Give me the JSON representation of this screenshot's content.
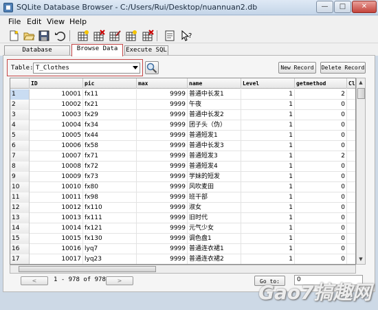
{
  "window": {
    "title": "SQLite Database Browser - C:/Users/Rui/Desktop/nuannuan2.db"
  },
  "menu": [
    "File",
    "Edit",
    "View",
    "Help"
  ],
  "toolbar": {
    "icons": [
      "new-database-icon",
      "open-database-icon",
      "save-icon",
      "undo-icon",
      "create-table-icon",
      "delete-table-icon",
      "modify-table-icon",
      "create-index-icon",
      "delete-index-icon",
      "log-window-icon",
      "whats-this-icon"
    ]
  },
  "tabs": [
    {
      "label": "Database Structure",
      "active": false
    },
    {
      "label": "Browse Data",
      "active": true
    },
    {
      "label": "Execute SQL",
      "active": false
    }
  ],
  "browse": {
    "table_label": "Table:",
    "table_value": "T_Clothes",
    "new_record_label": "New Record",
    "delete_record_label": "Delete Record"
  },
  "grid": {
    "columns": [
      "ID",
      "pic",
      "max",
      "name",
      "Level",
      "getmethod",
      "Clе"
    ],
    "rows": [
      [
        "1",
        "10001",
        "fx11",
        "9999",
        "普通中长发1",
        "1",
        "2"
      ],
      [
        "2",
        "10002",
        "fx21",
        "9999",
        "午夜",
        "1",
        "0"
      ],
      [
        "3",
        "10003",
        "fx29",
        "9999",
        "普通中长发2",
        "1",
        "0"
      ],
      [
        "4",
        "10004",
        "fx34",
        "9999",
        "团子头（伪）",
        "1",
        "0"
      ],
      [
        "5",
        "10005",
        "fx44",
        "9999",
        "普通短发1",
        "1",
        "0"
      ],
      [
        "6",
        "10006",
        "fx58",
        "9999",
        "普通中长发3",
        "1",
        "0"
      ],
      [
        "7",
        "10007",
        "fx71",
        "9999",
        "普通短发3",
        "1",
        "2"
      ],
      [
        "8",
        "10008",
        "fx72",
        "9999",
        "普通短发4",
        "1",
        "0"
      ],
      [
        "9",
        "10009",
        "fx73",
        "9999",
        "学妹的短发",
        "1",
        "0"
      ],
      [
        "10",
        "10010",
        "fx80",
        "9999",
        "风吹麦田",
        "1",
        "0"
      ],
      [
        "11",
        "10011",
        "fx98",
        "9999",
        "班干部",
        "1",
        "0"
      ],
      [
        "12",
        "10012",
        "fx110",
        "9999",
        "淑女",
        "1",
        "0"
      ],
      [
        "13",
        "10013",
        "fx111",
        "9999",
        "旧时代",
        "1",
        "0"
      ],
      [
        "14",
        "10014",
        "fx121",
        "9999",
        "元气少女",
        "1",
        "0"
      ],
      [
        "15",
        "10015",
        "fx130",
        "9999",
        "调色盘1",
        "1",
        "0"
      ],
      [
        "16",
        "10016",
        "lyq7",
        "9999",
        "普通连衣裙1",
        "1",
        "0"
      ],
      [
        "17",
        "10017",
        "lyq23",
        "9999",
        "普通连衣裙2",
        "1",
        "0"
      ]
    ]
  },
  "footer": {
    "prev_label": "<",
    "next_label": ">",
    "record_count": "1 - 978 of 978",
    "goto_label": "Go to:",
    "goto_value": "0"
  },
  "watermark": {
    "text": "Gao7搞趣网"
  }
}
